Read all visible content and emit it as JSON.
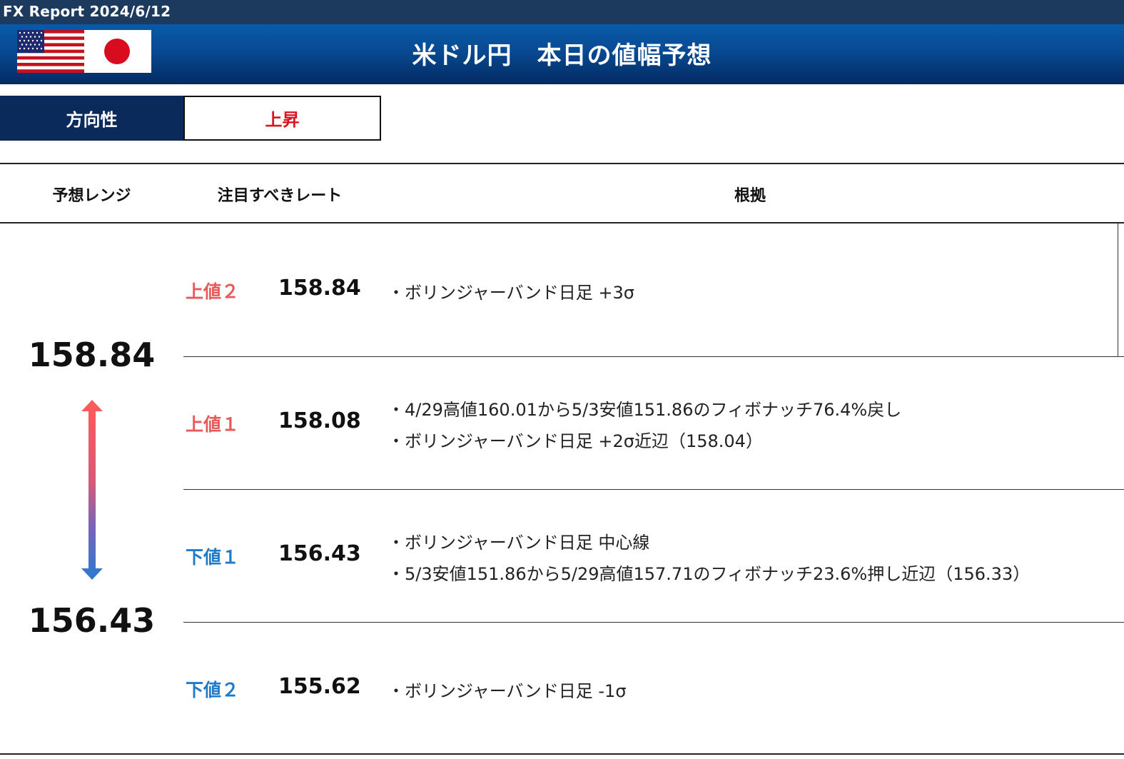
{
  "header": {
    "report_title": "FX Report 2024/6/12",
    "banner_title": "米ドル円　本日の値幅予想"
  },
  "direction": {
    "label": "方向性",
    "value": "上昇"
  },
  "columns": {
    "range": "予想レンジ",
    "rate": "注目すべきレート",
    "basis": "根拠"
  },
  "range": {
    "high": "158.84",
    "low": "156.43"
  },
  "colors": {
    "up": "#e85a5a",
    "down": "#1f7ac8",
    "direction_value": "#d8141e",
    "banner": "#074a92"
  },
  "levels": [
    {
      "label": "上値２",
      "rate": "158.84",
      "reasons": [
        "・ボリンジャーバンド日足 +3σ"
      ]
    },
    {
      "label": "上値１",
      "rate": "158.08",
      "reasons": [
        "・4/29高値160.01から5/3安値151.86のフィボナッチ76.4%戻し",
        "・ボリンジャーバンド日足 +2σ近辺（158.04）"
      ]
    },
    {
      "label": "下値１",
      "rate": "156.43",
      "reasons": [
        "・ボリンジャーバンド日足 中心線",
        "・5/3安値151.86から5/29高値157.71のフィボナッチ23.6%押し近辺（156.33）"
      ]
    },
    {
      "label": "下値２",
      "rate": "155.62",
      "reasons": [
        "・ボリンジャーバンド日足 -1σ"
      ]
    }
  ]
}
